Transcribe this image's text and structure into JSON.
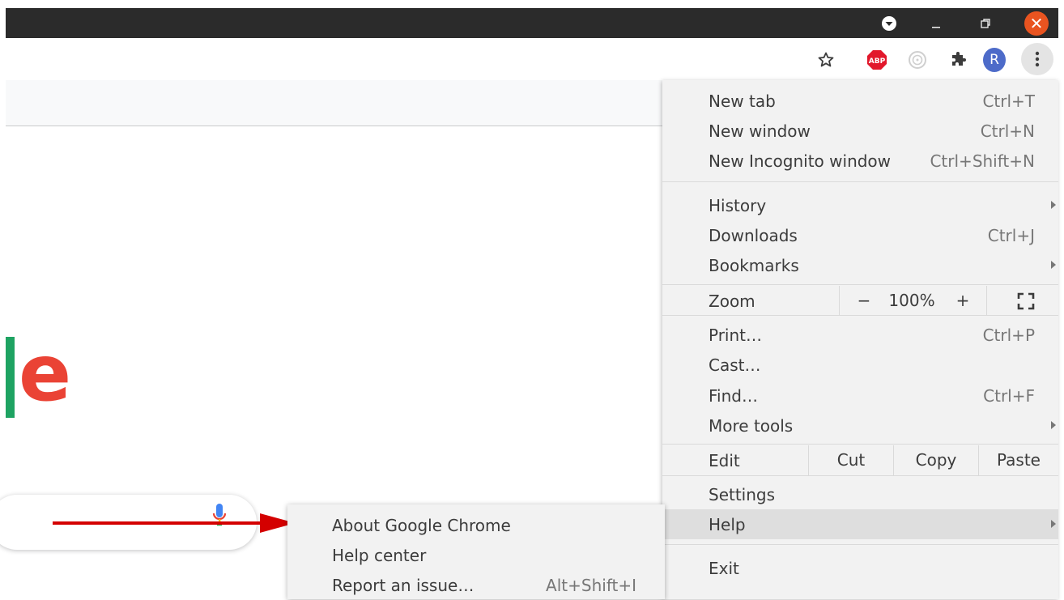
{
  "titlebar": {
    "close_glyph": "✕"
  },
  "toolbar": {
    "avatar_letter": "R",
    "abp_label": "ABP"
  },
  "logo": {
    "letters": "e"
  },
  "menu": {
    "items": [
      {
        "label": "New tab",
        "shortcut": "Ctrl+T"
      },
      {
        "label": "New window",
        "shortcut": "Ctrl+N"
      },
      {
        "label": "New Incognito window",
        "shortcut": "Ctrl+Shift+N"
      },
      {
        "label": "History",
        "shortcut": ""
      },
      {
        "label": "Downloads",
        "shortcut": "Ctrl+J"
      },
      {
        "label": "Bookmarks",
        "shortcut": ""
      },
      {
        "label": "Print…",
        "shortcut": "Ctrl+P"
      },
      {
        "label": "Cast…",
        "shortcut": ""
      },
      {
        "label": "Find…",
        "shortcut": "Ctrl+F"
      },
      {
        "label": "More tools",
        "shortcut": ""
      },
      {
        "label": "Settings",
        "shortcut": ""
      },
      {
        "label": "Help",
        "shortcut": ""
      },
      {
        "label": "Exit",
        "shortcut": ""
      }
    ],
    "zoom": {
      "label": "Zoom",
      "minus": "−",
      "value": "100%",
      "plus": "+"
    },
    "edit": {
      "label": "Edit",
      "cut": "Cut",
      "copy": "Copy",
      "paste": "Paste"
    }
  },
  "help_submenu": {
    "items": [
      {
        "label": "About Google Chrome",
        "shortcut": ""
      },
      {
        "label": "Help center",
        "shortcut": ""
      },
      {
        "label": "Report an issue…",
        "shortcut": "Alt+Shift+I"
      }
    ]
  },
  "colors": {
    "titlebar": "#2b2b2b",
    "close": "#e95420",
    "arrow": "#d40000",
    "menu_bg": "#f2f2f2",
    "highlight": "#dedede",
    "avatar": "#4d6bc9",
    "abp": "#e2172b"
  }
}
